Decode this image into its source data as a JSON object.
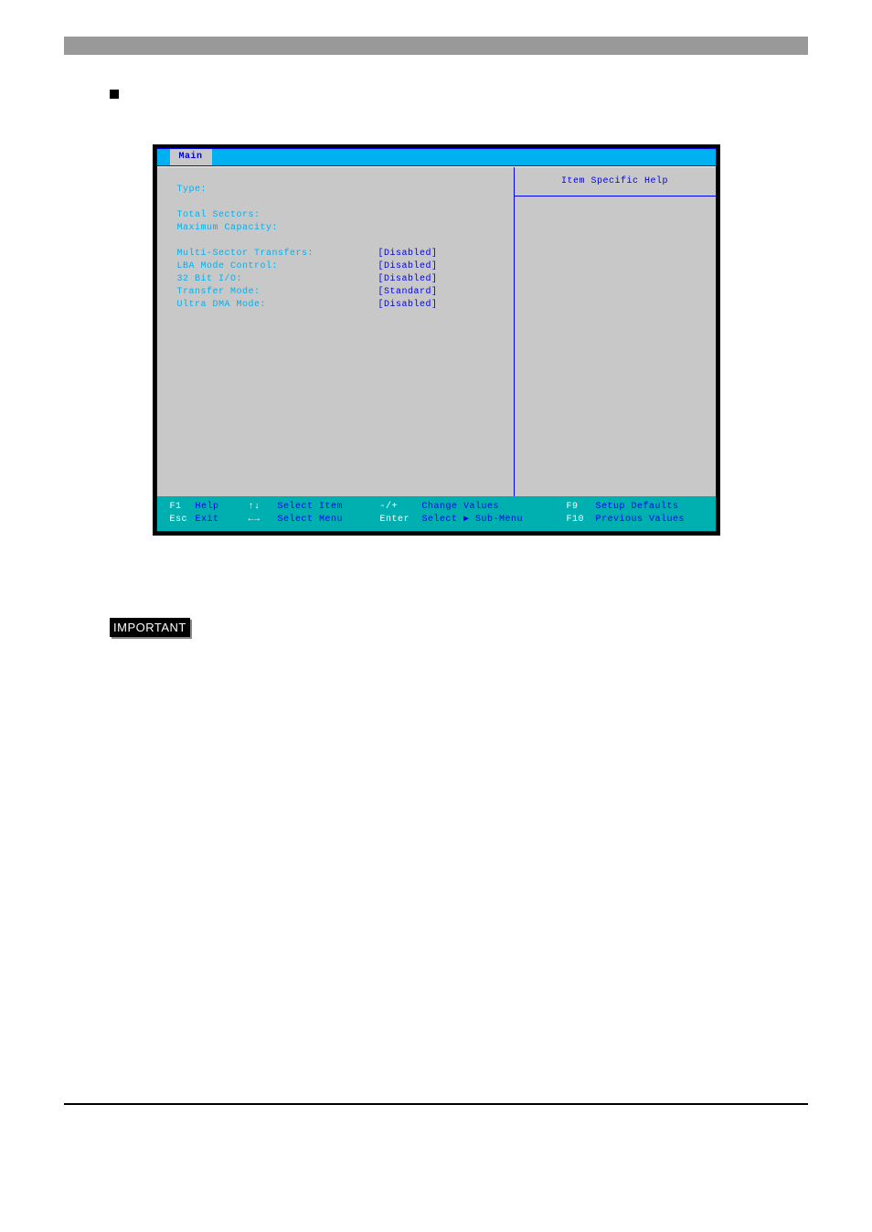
{
  "tab": "Main",
  "help_title": "Item Specific Help",
  "fields": {
    "type": "Type:",
    "total_sectors": "Total Sectors:",
    "max_capacity": "Maximum Capacity:",
    "multi_sector": "Multi-Sector Transfers:",
    "lba_mode": "LBA Mode Control:",
    "bit32": "32 Bit I/O:",
    "transfer_mode": "Transfer Mode:",
    "ultra_dma": "Ultra DMA Mode:"
  },
  "values": {
    "multi_sector": "[Disabled]",
    "lba_mode": "[Disabled]",
    "bit32": "[Disabled]",
    "transfer_mode": "[Standard]",
    "ultra_dma": "[Disabled]"
  },
  "footer": {
    "f1_key": "F1",
    "f1_label": "Help",
    "esc_key": "Esc",
    "esc_label": "Exit",
    "ud_key": "↑↓",
    "ud_label": "Select Item",
    "lr_key": "←→",
    "lr_label": "Select Menu",
    "pm_key": "-/+",
    "pm_label": "Change Values",
    "enter_key": "Enter",
    "enter_label": "Select ▶ Sub-Menu",
    "f9_key": "F9",
    "f9_label": "Setup Defaults",
    "f10_key": "F10",
    "f10_label": "Previous Values"
  },
  "important_label": "IMPORTANT"
}
